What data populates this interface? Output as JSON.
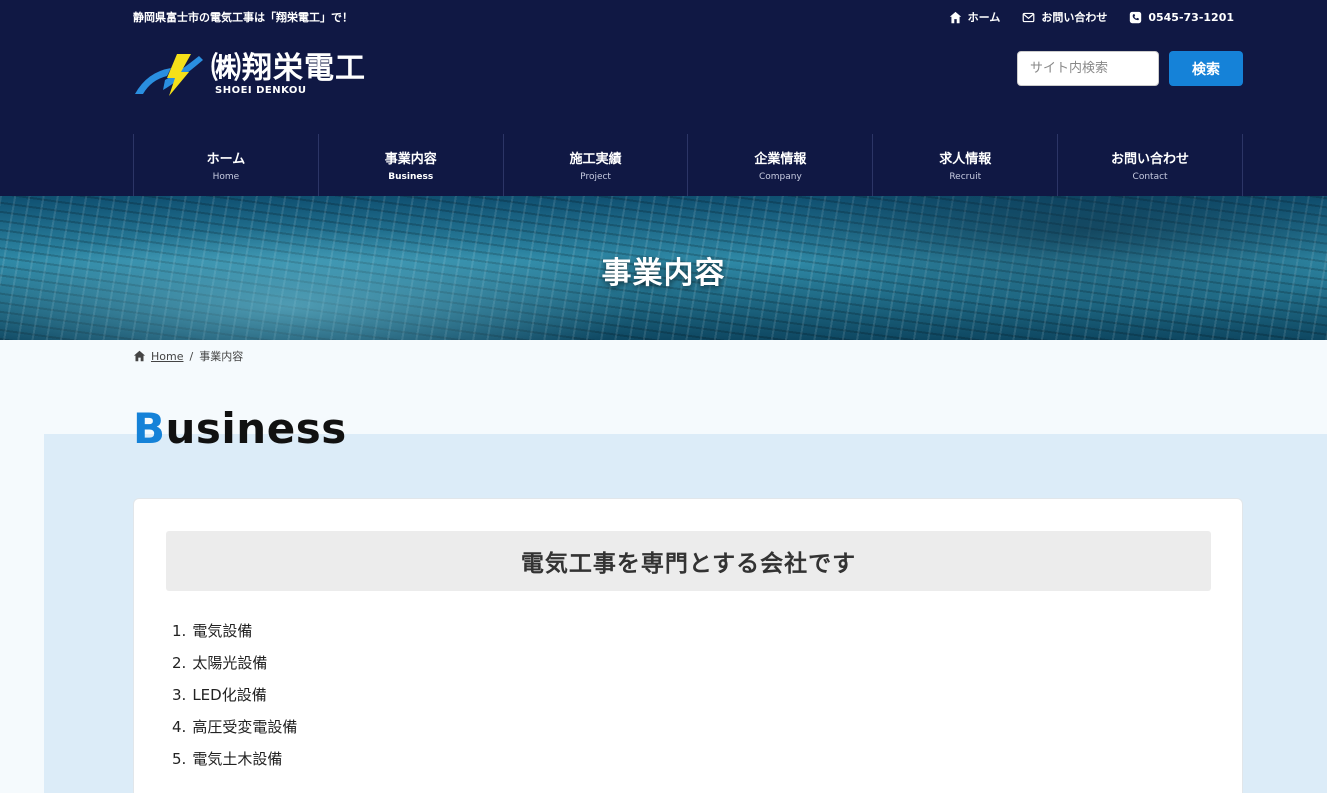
{
  "header": {
    "tagline": "静岡県富士市の電気工事は「翔栄電工」で！",
    "top_links": [
      {
        "label": "ホーム",
        "icon": "home-icon"
      },
      {
        "label": "お問い合わせ",
        "icon": "envelope-icon"
      },
      {
        "label": "0545-73-1201",
        "icon": "phone-icon"
      }
    ],
    "logo": {
      "jp": "㈱翔栄電工",
      "en": "SHOEI DENKOU"
    },
    "search": {
      "placeholder": "サイト内検索",
      "button": "検索"
    },
    "nav": [
      {
        "jp": "ホーム",
        "en": "Home"
      },
      {
        "jp": "事業内容",
        "en": "Business"
      },
      {
        "jp": "施工実績",
        "en": "Project"
      },
      {
        "jp": "企業情報",
        "en": "Company"
      },
      {
        "jp": "求人情報",
        "en": "Recruit"
      },
      {
        "jp": "お問い合わせ",
        "en": "Contact"
      }
    ]
  },
  "hero": {
    "title": "事業内容"
  },
  "breadcrumb": {
    "home": "Home",
    "separator": "/",
    "current": "事業内容"
  },
  "section": {
    "title_first": "B",
    "title_rest": "usiness"
  },
  "card": {
    "heading": "電気工事を専門とする会社です",
    "services": [
      {
        "num": "1.",
        "label": "電気設備"
      },
      {
        "num": "2.",
        "label": "太陽光設備"
      },
      {
        "num": "3.",
        "label": "LED化設備"
      },
      {
        "num": "4.",
        "label": "高圧受変電設備"
      },
      {
        "num": "5.",
        "label": "電気土木設備"
      }
    ]
  },
  "colors": {
    "header_bg": "#101844",
    "accent": "#1582d8",
    "panel_bg": "#dcecf8"
  }
}
